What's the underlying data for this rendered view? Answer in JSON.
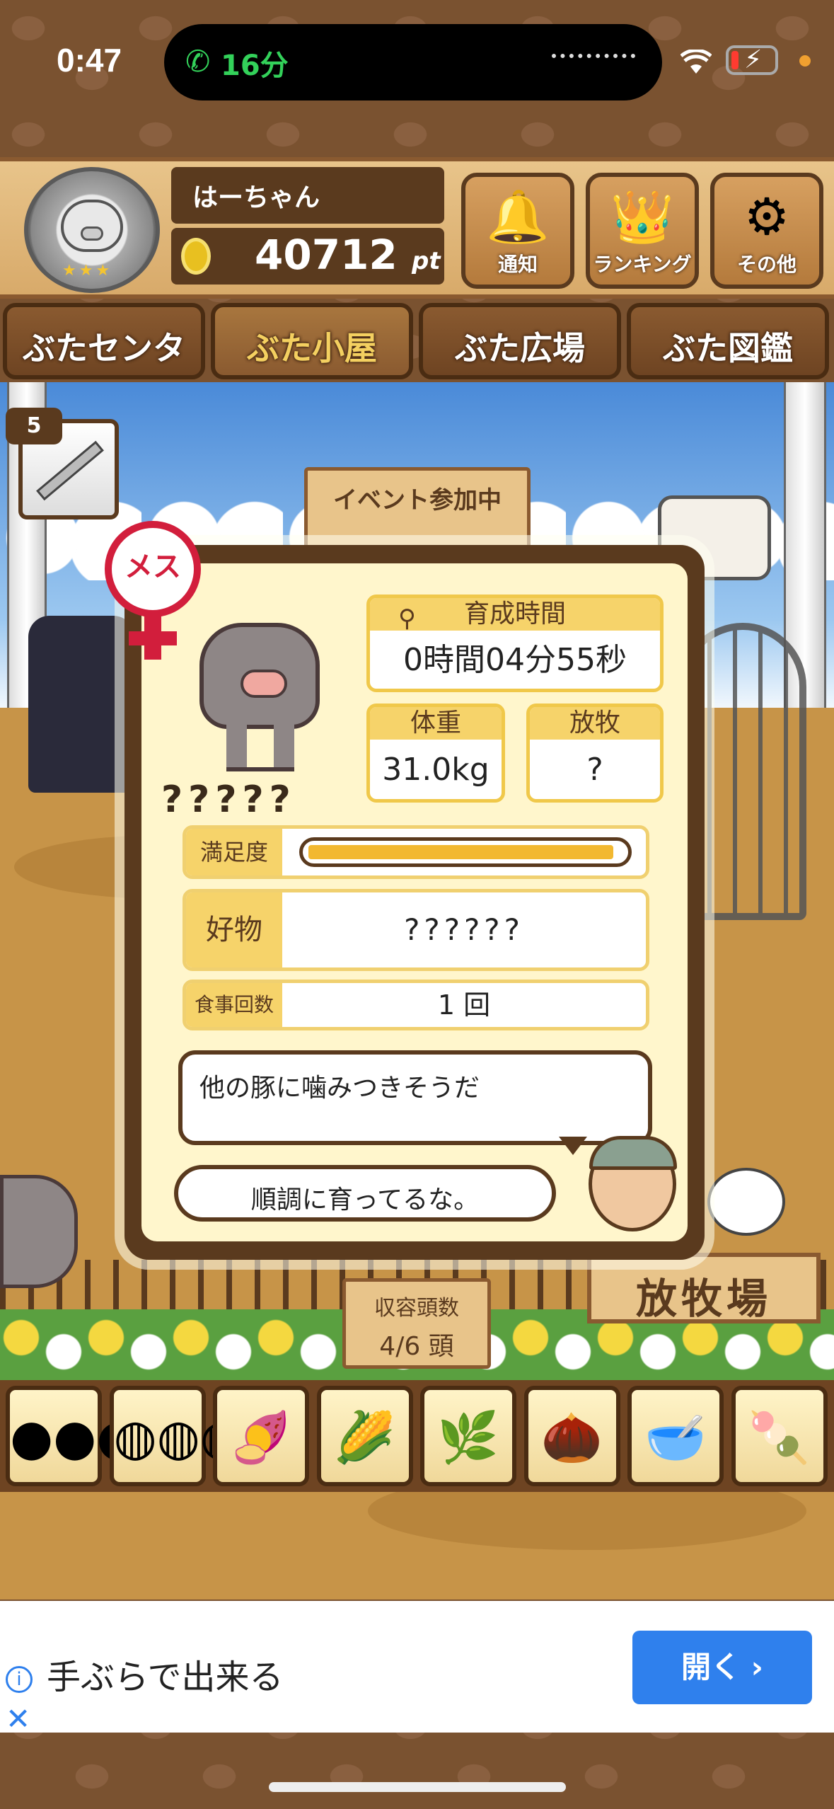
{
  "status_bar": {
    "time": "0:47",
    "call_duration": "16分"
  },
  "player": {
    "name": "はーちゃん",
    "points": "40712",
    "points_unit": "pt"
  },
  "header_buttons": {
    "notify": "通知",
    "ranking": "ランキング",
    "other": "その他"
  },
  "nav_tabs": [
    "ぶたセンター",
    "ぶた小屋",
    "ぶた広場",
    "ぶた図鑑"
  ],
  "syringe_count": "5",
  "scene": {
    "event_sign": "イベント参加中",
    "capacity_label": "収容頭数",
    "capacity_value": "4/6 頭",
    "pasture_sign": "放牧場"
  },
  "pig_card": {
    "gender": "メス",
    "name": "?????",
    "growth_time_label": "育成時間",
    "growth_time_value": "0時間04分55秒",
    "weight_label": "体重",
    "weight_value": "31.0kg",
    "grazing_label": "放牧",
    "grazing_value": "?",
    "satisfaction_label": "満足度",
    "satisfaction_fraction": 0.97,
    "favorite_label": "好物",
    "favorite_value": "??????",
    "meals_label": "食事回数",
    "meals_value": "1 回",
    "pig_thought": "他の豚に噛みつきそうだ",
    "farmer_comment": "順調に育ってるな。"
  },
  "feed_icons": [
    "corn-pile-icon",
    "grain-pile-icon",
    "sweet-potato-icon",
    "corn-cob-icon",
    "soybean-icon",
    "acorn-icon",
    "bowl-feed-icon",
    "meatball-plate-icon"
  ],
  "feed_glyphs": [
    "●●●",
    "◍◍◍",
    "🍠",
    "🌽",
    "🌿",
    "🌰",
    "🥣",
    "🍡"
  ],
  "ad": {
    "text": "手ぶらで出来る",
    "open_button": "開く ›"
  },
  "colors": {
    "wood": "#d8aa6a",
    "popup_bg": "#fff6cc",
    "accent_yellow": "#f6d36a",
    "gender_red": "#d21e3c",
    "ad_blue": "#2f80ed"
  }
}
